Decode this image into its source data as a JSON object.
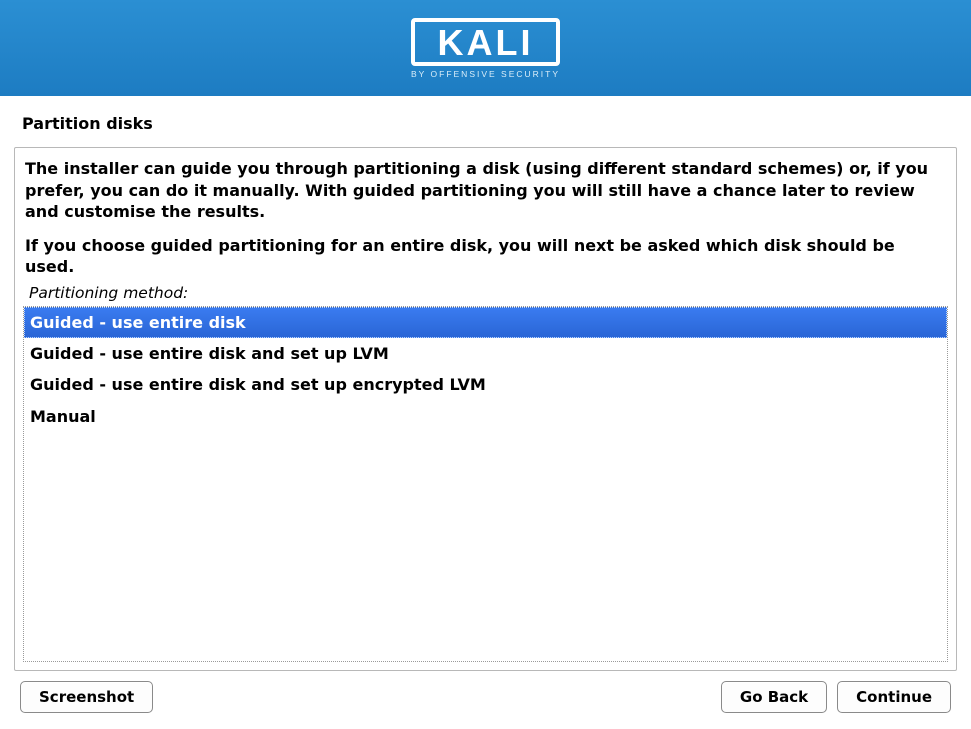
{
  "banner": {
    "brand": "KALI",
    "tagline": "BY OFFENSIVE SECURITY"
  },
  "page": {
    "title": "Partition disks",
    "intro1": "The installer can guide you through partitioning a disk (using different standard schemes) or, if you prefer, you can do it manually. With guided partitioning you will still have a chance later to review and customise the results.",
    "intro2": "If you choose guided partitioning for an entire disk, you will next be asked which disk should be used.",
    "list_label": "Partitioning method:",
    "options": [
      "Guided - use entire disk",
      "Guided - use entire disk and set up LVM",
      "Guided - use entire disk and set up encrypted LVM",
      "Manual"
    ],
    "selected_index": 0
  },
  "footer": {
    "screenshot": "Screenshot",
    "go_back": "Go Back",
    "continue": "Continue"
  }
}
